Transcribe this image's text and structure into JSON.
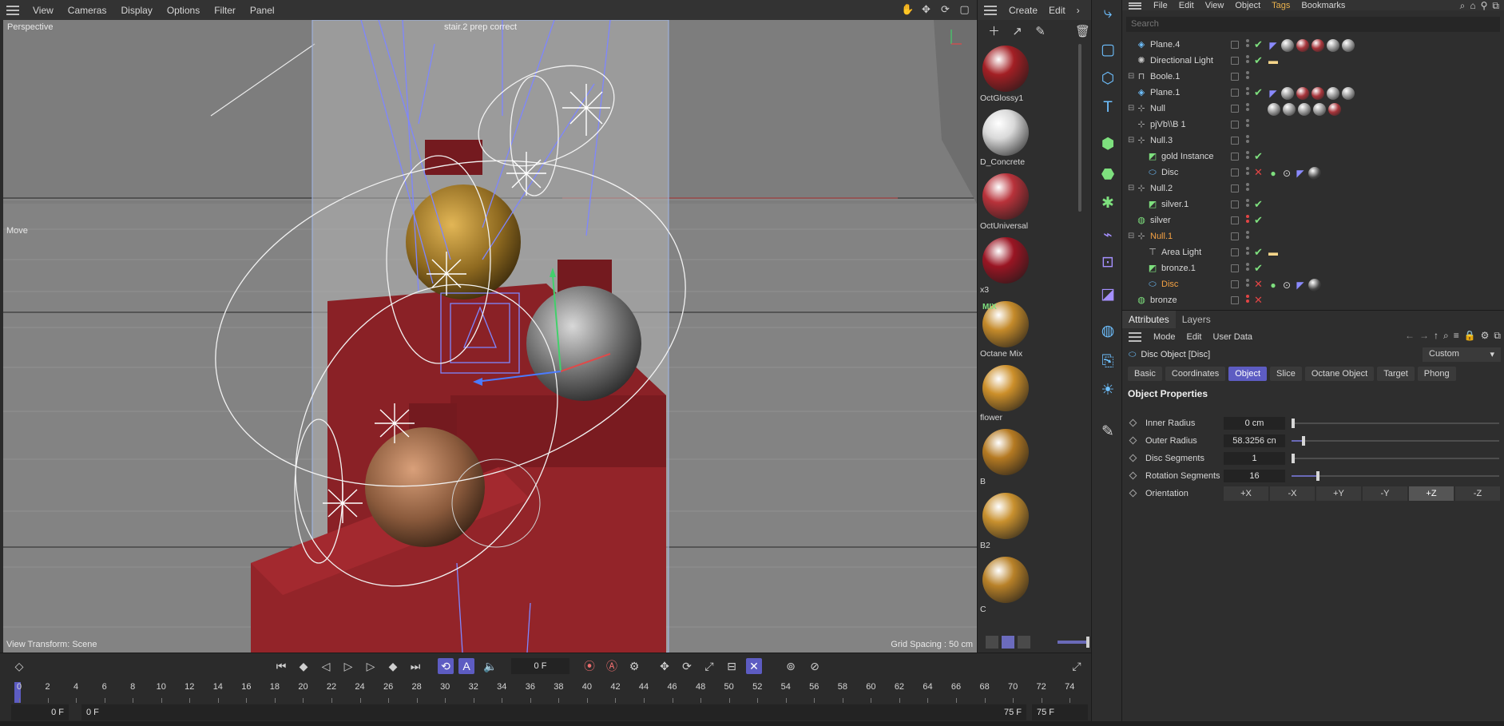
{
  "viewport": {
    "menu": [
      "View",
      "Cameras",
      "Display",
      "Options",
      "Filter",
      "Panel"
    ],
    "view_name": "Perspective",
    "camera_label": "stair.2 prep correct",
    "move_label": "Move",
    "view_transform": "View Transform: Scene",
    "grid_spacing": "Grid Spacing : 50 cm"
  },
  "materials": {
    "menu": [
      "Create",
      "Edit"
    ],
    "items": [
      {
        "name": "OctGlossy1",
        "color": "#a31f24"
      },
      {
        "name": "D_Concrete",
        "color": "#d9d9d9"
      },
      {
        "name": "OctUniversal",
        "color": "#b8323a"
      },
      {
        "name": "x3",
        "color": "#9a1523"
      },
      {
        "name": "Octane Mix",
        "color": "#c48a2a",
        "badge": "MIX"
      },
      {
        "name": "flower",
        "color": "#cc8f2a"
      },
      {
        "name": "B",
        "color": "#b57a22"
      },
      {
        "name": "B2",
        "color": "#c8902e"
      },
      {
        "name": "C",
        "color": "#b88128"
      }
    ]
  },
  "object_manager": {
    "menu": [
      "File",
      "Edit",
      "View",
      "Object",
      "Tags",
      "Bookmarks"
    ],
    "active_menu": "Tags",
    "search_placeholder": "Search",
    "rows": [
      {
        "name": "Plane.4",
        "indent": 0,
        "icon": "plane-icon",
        "flag": "check",
        "tags": [
          "material-flag",
          "grey",
          "red",
          "red",
          "grey",
          "grey"
        ]
      },
      {
        "name": "Directional Light",
        "indent": 0,
        "icon": "light-icon",
        "flag": "check",
        "tags": [
          "light-tag"
        ]
      },
      {
        "name": "Boole.1",
        "indent": 0,
        "icon": "boole-icon",
        "expand": true,
        "flag": "",
        "tags": []
      },
      {
        "name": "Plane.1",
        "indent": 0,
        "icon": "plane-icon",
        "flag": "check",
        "tags": [
          "material-flag",
          "grey",
          "red",
          "red",
          "grey",
          "grey"
        ]
      },
      {
        "name": "Null",
        "indent": 0,
        "icon": "null-icon",
        "expand": true,
        "flag": "",
        "tags": [
          "grey",
          "grey",
          "grey",
          "grey",
          "red"
        ]
      },
      {
        "name": "pjVb\\\\B 1",
        "indent": 0,
        "icon": "null-icon",
        "flag": "",
        "tags": []
      },
      {
        "name": "Null.3",
        "indent": 0,
        "icon": "null-icon",
        "expand": true,
        "flag": "",
        "tags": []
      },
      {
        "name": "gold Instance",
        "indent": 1,
        "icon": "instance-icon",
        "flag": "check",
        "tags": []
      },
      {
        "name": "Disc",
        "indent": 1,
        "icon": "disc-icon",
        "flag": "cross",
        "tags": [
          "green-tag",
          "target-tag",
          "material-flag",
          "phong-tag"
        ]
      },
      {
        "name": "Null.2",
        "indent": 0,
        "icon": "null-icon",
        "expand": true,
        "flag": "",
        "tags": []
      },
      {
        "name": "silver.1",
        "indent": 1,
        "icon": "instance-icon",
        "flag": "check",
        "tags": []
      },
      {
        "name": "silver",
        "indent": 0,
        "icon": "sphere-icon",
        "flag": "check",
        "dots_red": true,
        "tags": []
      },
      {
        "name": "Null.1",
        "indent": 0,
        "icon": "null-icon",
        "expand": true,
        "flag": "",
        "orange": true,
        "tags": []
      },
      {
        "name": "Area Light",
        "indent": 1,
        "icon": "area-light-icon",
        "flag": "check",
        "tags": [
          "light-tag"
        ]
      },
      {
        "name": "bronze.1",
        "indent": 1,
        "icon": "instance-icon",
        "flag": "check",
        "tags": []
      },
      {
        "name": "Disc",
        "indent": 1,
        "icon": "disc-icon",
        "flag": "cross",
        "orange": true,
        "tags": [
          "green-tag",
          "target-tag",
          "material-flag",
          "phong-tag"
        ]
      },
      {
        "name": "bronze",
        "indent": 0,
        "icon": "sphere-icon",
        "flag": "cross",
        "dots_red": true,
        "tags": []
      }
    ]
  },
  "attributes": {
    "tabs": [
      "Attributes",
      "Layers"
    ],
    "menu": [
      "Mode",
      "Edit",
      "User Data"
    ],
    "object_title": "Disc Object [Disc]",
    "mode_dropdown": "Custom",
    "subtabs": [
      "Basic",
      "Coordinates",
      "Object",
      "Slice",
      "Octane Object",
      "Target",
      "Phong"
    ],
    "active_subtab": "Object",
    "section_title": "Object Properties",
    "properties": [
      {
        "label": "Inner Radius",
        "value": "0 cm",
        "slider": 0.0
      },
      {
        "label": "Outer Radius",
        "value": "58.3256 cn",
        "slider": 0.05
      },
      {
        "label": "Disc Segments",
        "value": "1",
        "slider": 0.0
      },
      {
        "label": "Rotation Segments",
        "value": "16",
        "slider": 0.12
      }
    ],
    "orientation": {
      "label": "Orientation",
      "options": [
        "+X",
        "-X",
        "+Y",
        "-Y",
        "+Z",
        "-Z"
      ],
      "active": "+Z"
    }
  },
  "timeline": {
    "current_frame": "0 F",
    "ticks": [
      0,
      2,
      4,
      6,
      8,
      10,
      12,
      14,
      16,
      18,
      20,
      22,
      24,
      26,
      28,
      30,
      32,
      34,
      36,
      38,
      40,
      42,
      44,
      46,
      48,
      50,
      52,
      54,
      56,
      58,
      60,
      62,
      64,
      66,
      68,
      70,
      72,
      74
    ],
    "start_field": "0 F",
    "min_field": "0 F",
    "max_field": "75 F",
    "end_field": "75 F"
  }
}
